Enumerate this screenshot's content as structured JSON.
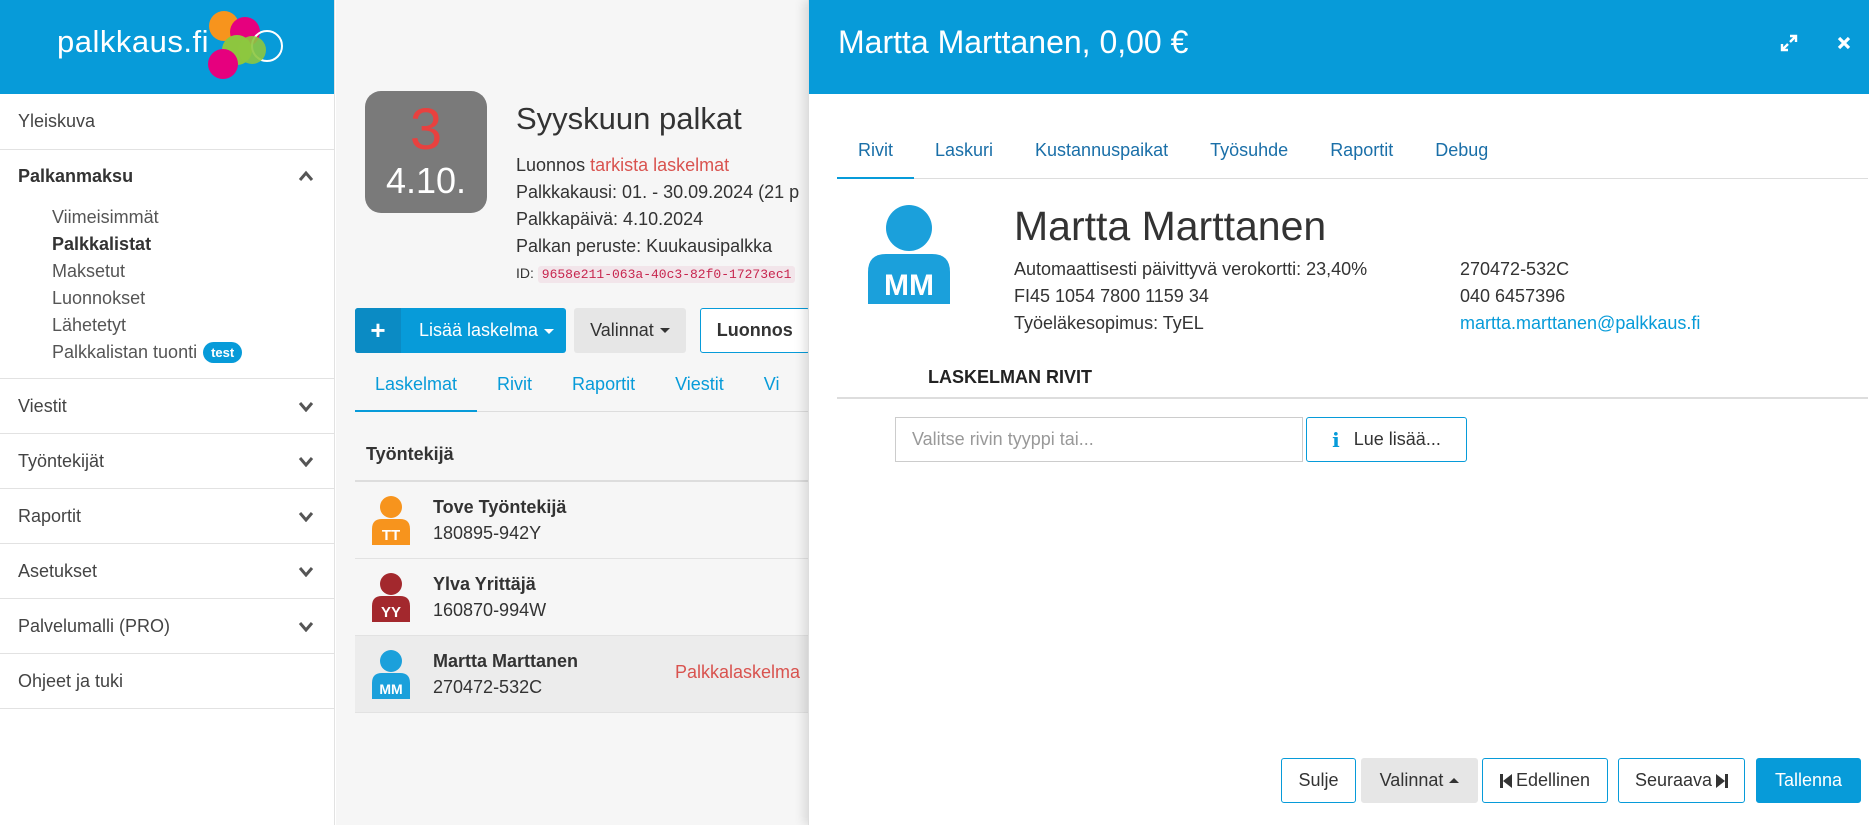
{
  "brand": {
    "name": "palkkaus.fi"
  },
  "sidebar": {
    "items": [
      {
        "label": "Yleiskuva"
      },
      {
        "label": "Palkanmaksu"
      },
      {
        "label": "Viestit"
      },
      {
        "label": "Työntekijät"
      },
      {
        "label": "Raportit"
      },
      {
        "label": "Asetukset"
      },
      {
        "label": "Palvelumalli (PRO)"
      },
      {
        "label": "Ohjeet ja tuki"
      }
    ],
    "subitems": [
      {
        "label": "Viimeisimmät"
      },
      {
        "label": "Palkkalistat"
      },
      {
        "label": "Maksetut"
      },
      {
        "label": "Luonnokset"
      },
      {
        "label": "Lähetetyt"
      },
      {
        "label": "Palkkalistan tuonti",
        "badge": "test"
      }
    ]
  },
  "run": {
    "count": "3",
    "date": "4.10.",
    "title": "Syyskuun palkat",
    "status_prefix": "Luonnos",
    "status_link": "tarkista laskelmat",
    "period": "Palkkakausi: 01. - 30.09.2024 (21 p",
    "payday": "Palkkapäivä: 4.10.2024",
    "basis": "Palkan peruste: Kuukausipalkka",
    "id_label": "ID:",
    "id_value": "9658e211-063a-40c3-82f0-17273ec1"
  },
  "toolbar": {
    "add_label": "Lisää laskelma",
    "options_label": "Valinnat",
    "draft_label": "Luonnos"
  },
  "main_tabs": [
    {
      "label": "Laskelmat"
    },
    {
      "label": "Rivit"
    },
    {
      "label": "Raportit"
    },
    {
      "label": "Viestit"
    },
    {
      "label": "Vi"
    }
  ],
  "table": {
    "header": "Työntekijä",
    "rows": [
      {
        "name": "Tove Työntekijä",
        "id": "180895-942Y",
        "initials": "TT",
        "color": "#f7941d",
        "status": ""
      },
      {
        "name": "Ylva Yrittäjä",
        "id": "160870-994W",
        "initials": "YY",
        "color": "#a3282d",
        "status": ""
      },
      {
        "name": "Martta Marttanen",
        "id": "270472-532C",
        "initials": "MM",
        "color": "#1ba0db",
        "status": "Palkkalaskelma"
      }
    ]
  },
  "panel": {
    "title": "Martta Marttanen, 0,00 €",
    "tabs": [
      {
        "label": "Rivit"
      },
      {
        "label": "Laskuri"
      },
      {
        "label": "Kustannuspaikat"
      },
      {
        "label": "Työsuhde"
      },
      {
        "label": "Raportit"
      },
      {
        "label": "Debug"
      }
    ],
    "person": {
      "initials": "MM",
      "name": "Martta Marttanen",
      "tax_card": "Automaattisesti päivittyvä verokortti: 23,40%",
      "iban": "FI45 1054 7800 1159 34",
      "pension": "Työeläkesopimus: TyEL",
      "ssn": "270472-532C",
      "phone": "040 6457396",
      "email": "martta.marttanen@palkkaus.fi"
    },
    "section_title": "LASKELMAN RIVIT",
    "row_input_placeholder": "Valitse rivin tyyppi tai...",
    "info_button": "Lue lisää...",
    "footer": {
      "close": "Sulje",
      "options": "Valinnat",
      "prev": "Edellinen",
      "next": "Seuraava",
      "save": "Tallenna"
    }
  },
  "colors": {
    "accent": "#079bd9",
    "danger": "#d9534f",
    "datebox": "#7a7a7a"
  }
}
